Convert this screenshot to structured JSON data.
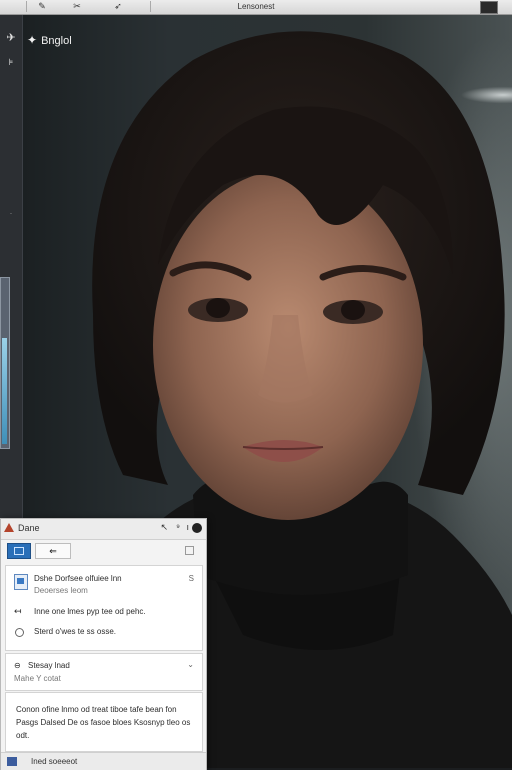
{
  "toolbar": {
    "title": "Lensonest",
    "icons": [
      "pen-tool-icon",
      "scissors-icon",
      "lasso-icon"
    ]
  },
  "canvas": {
    "label": "Bnglol",
    "label_icon": "sparkle-icon"
  },
  "panel": {
    "title": "Dane",
    "tab_b_label": "⇐",
    "file": {
      "name": "Dshe Dorfsee olfuiee lnn",
      "meta": "Deoerses leom",
      "badge": "S"
    },
    "action1": "Inne one lmes pyp tee od pehc.",
    "action2": "Sterd o'wes te ss osse.",
    "section": {
      "title": "Stesay lnad",
      "sub": "Mahe Y cotat"
    },
    "paragraph": "Conon ofine lnmo od treat tiboe tafe bean fon Pasgs Dalsed De os fasoe bloes Ksosnyp tleo os odt.",
    "footer": "Ined soeeeot"
  },
  "colors": {
    "accent": "#2a6fb8",
    "warning": "#b4442c",
    "rail": "#2c2f33"
  }
}
